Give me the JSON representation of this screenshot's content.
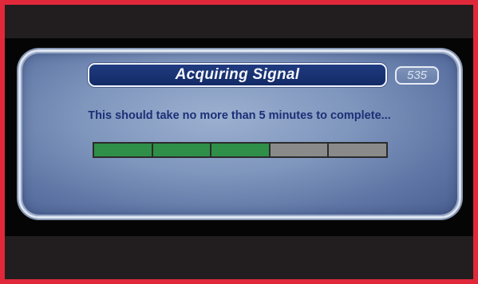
{
  "dialog": {
    "title": "Acquiring Signal",
    "channel": "535",
    "message": "This should take no more than 5 minutes to complete..."
  },
  "progress": {
    "segments_total": 5,
    "segments_filled": 3,
    "fraction": 0.6,
    "filled_color": "#2f8f48",
    "empty_color": "#8a8a8a"
  },
  "colors": {
    "frame_border": "#e0283a",
    "title_bar": "#1f3b80",
    "message_text": "#1c2f76",
    "dialog_bg": "#7f96bd"
  }
}
